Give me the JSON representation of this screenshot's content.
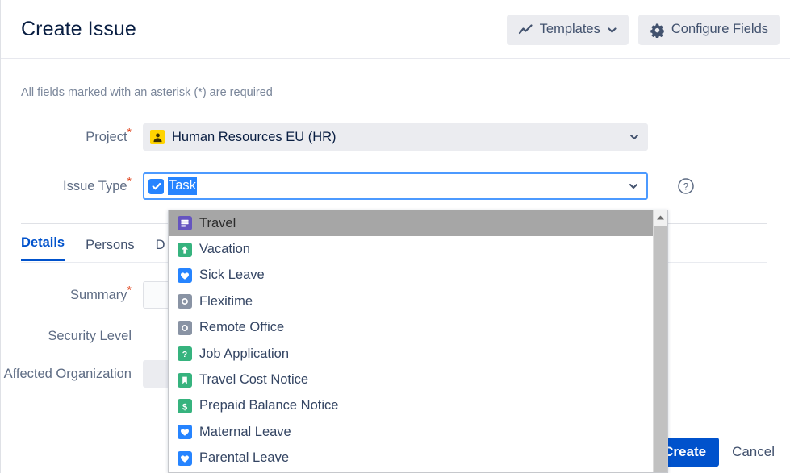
{
  "header": {
    "title": "Create Issue",
    "templates_button": {
      "label": "Templates",
      "icon": "trend-line-icon",
      "chevron": "chevron-down-icon"
    },
    "configure_button": {
      "label": "Configure Fields",
      "icon": "gear-icon"
    }
  },
  "body": {
    "required_note": "All fields marked with an asterisk (*) are required"
  },
  "fields": {
    "project": {
      "label": "Project",
      "required_marker": "*",
      "value": "Human Resources EU (HR)",
      "icon": "project-avatar-icon"
    },
    "issue_type": {
      "label": "Issue Type",
      "required_marker": "*",
      "value": "Task",
      "value_selected": true,
      "icon": "checkbox-checked-icon",
      "help_icon": "question-circle-icon"
    },
    "summary": {
      "label": "Summary",
      "required_marker": "*",
      "value": "",
      "placeholder": ""
    },
    "security_level": {
      "label": "Security Level",
      "required_marker": "",
      "value": ""
    },
    "affected_organization": {
      "label": "Affected Organization",
      "required_marker": "",
      "value": "",
      "chevron": "chevron-down-icon"
    }
  },
  "tabs": [
    {
      "label": "Details",
      "active": true
    },
    {
      "label": "Persons",
      "active": false
    },
    {
      "label": "D",
      "active": false,
      "truncated": true
    }
  ],
  "issue_type_dropdown": {
    "open": true,
    "scrollbar": {
      "up_arrow": "caret-up-icon",
      "thumb_visible": true
    },
    "options": [
      {
        "label": "Travel",
        "icon": "task-lines-icon",
        "color": "#6554c0",
        "glyph": "lines",
        "selected": true
      },
      {
        "label": "Vacation",
        "icon": "arrow-up-icon",
        "color": "#36b37e",
        "glyph": "arrow-up",
        "selected": false
      },
      {
        "label": "Sick Leave",
        "icon": "heart-icon",
        "color": "#2684ff",
        "glyph": "heart",
        "selected": false
      },
      {
        "label": "Flexitime",
        "icon": "circle-dot-icon",
        "color": "#8993a4",
        "glyph": "ring",
        "selected": false
      },
      {
        "label": "Remote Office",
        "icon": "circle-dot-icon",
        "color": "#8993a4",
        "glyph": "ring",
        "selected": false
      },
      {
        "label": "Job Application",
        "icon": "question-mark-icon",
        "color": "#36b37e",
        "glyph": "question",
        "selected": false
      },
      {
        "label": "Travel Cost Notice",
        "icon": "bookmark-icon",
        "color": "#36b37e",
        "glyph": "bookmark",
        "selected": false
      },
      {
        "label": "Prepaid Balance Notice",
        "icon": "dollar-icon",
        "color": "#36b37e",
        "glyph": "dollar",
        "selected": false
      },
      {
        "label": "Maternal Leave",
        "icon": "heart-icon",
        "color": "#2684ff",
        "glyph": "heart",
        "selected": false
      },
      {
        "label": "Parental Leave",
        "icon": "heart-icon",
        "color": "#2684ff",
        "glyph": "heart",
        "selected": false
      }
    ]
  },
  "footer": {
    "create_label": "Create",
    "cancel_label": "Cancel"
  },
  "colors": {
    "brand_blue": "#0052cc",
    "focus_blue": "#4c9aff",
    "selection_blue": "#2684ff",
    "required_red": "#de350b",
    "project_yellow": "#ffd400",
    "field_grey": "#ebecf0",
    "label_grey": "#5e6c84",
    "highlight_grey": "#a6a6a6"
  }
}
